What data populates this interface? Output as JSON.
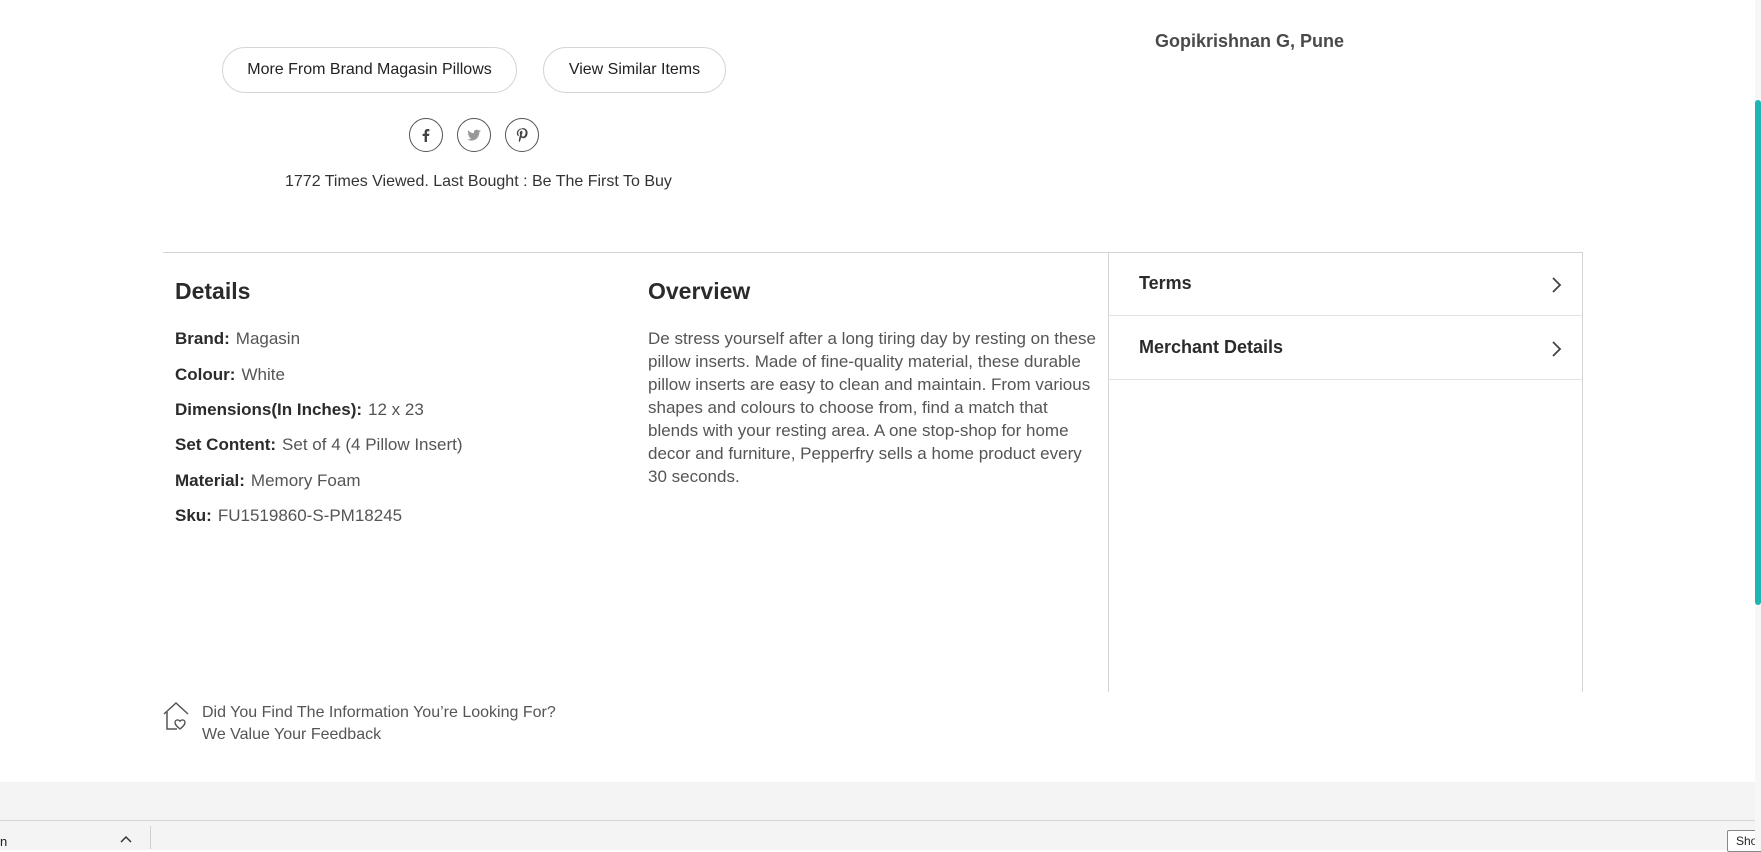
{
  "testimonial": {
    "author": "Gopikrishnan G, Pune"
  },
  "actions": {
    "more_from_brand": "More From Brand Magasin Pillows",
    "view_similar": "View Similar Items"
  },
  "share": {
    "icons": [
      "facebook-icon",
      "twitter-icon",
      "pinterest-icon"
    ]
  },
  "views_text": "1772 Times Viewed. Last Bought : Be The First To Buy",
  "details": {
    "title": "Details",
    "specs": [
      {
        "key": "Brand:",
        "value": "Magasin"
      },
      {
        "key": "Colour:",
        "value": "White"
      },
      {
        "key": "Dimensions(In Inches):",
        "value": "12 x 23"
      },
      {
        "key": "Set Content:",
        "value": "Set of 4 (4 Pillow Insert)"
      },
      {
        "key": "Material:",
        "value": "Memory Foam"
      },
      {
        "key": "Sku:",
        "value": "FU1519860-S-PM18245"
      }
    ]
  },
  "overview": {
    "title": "Overview",
    "text": "De stress yourself after a long tiring day by resting on these pillow inserts. Made of fine-quality material, these durable pillow inserts are easy to clean and maintain. From various shapes and colours to choose from, find a match that blends with your resting area. A one stop-shop for home decor and furniture, Pepperfry sells a home product every 30 seconds."
  },
  "accordion": [
    {
      "label": "Terms"
    },
    {
      "label": "Merchant Details"
    }
  ],
  "feedback": {
    "question": "Did You Find The Information You’re Looking For?",
    "sub": "We Value Your Feedback"
  },
  "bottom_bar": {
    "left_text": "n",
    "show_label": "Sho"
  },
  "colors": {
    "accent": "#1fb5b5",
    "border": "#d4d4d4",
    "text_muted": "#555555"
  }
}
